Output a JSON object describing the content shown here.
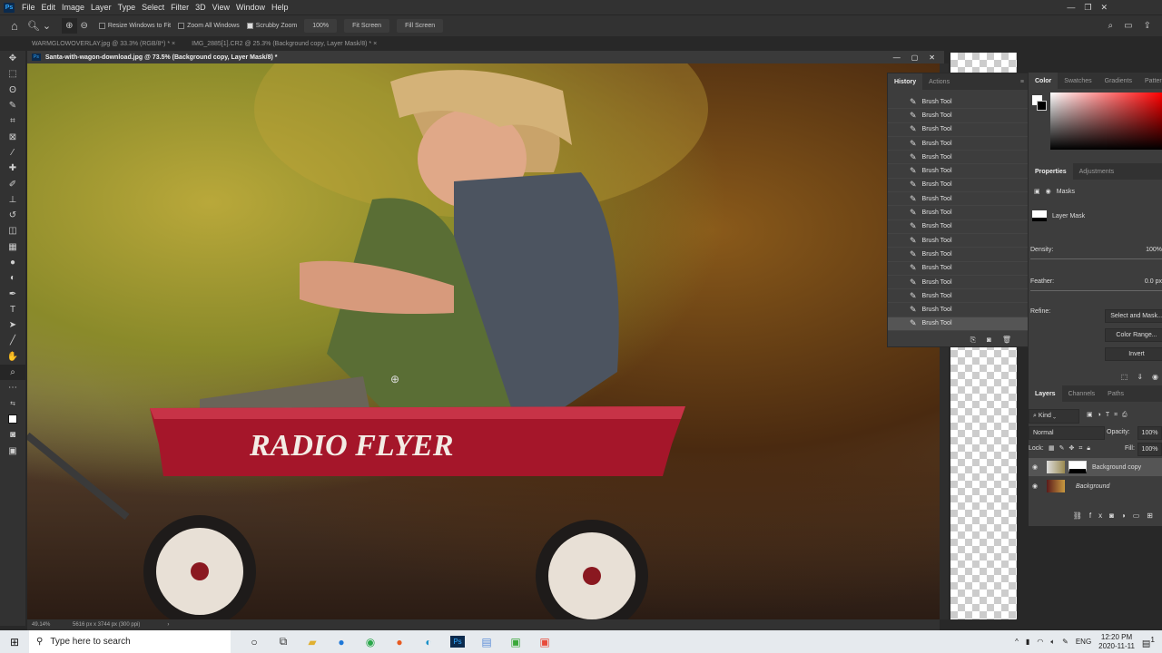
{
  "app": {
    "logo": "Ps"
  },
  "menu": [
    "File",
    "Edit",
    "Image",
    "Layer",
    "Type",
    "Select",
    "Filter",
    "3D",
    "View",
    "Window",
    "Help"
  ],
  "options": {
    "resize_windows": "Resize Windows to Fit",
    "resize_checked": false,
    "zoom_all": "Zoom All Windows",
    "zoom_all_checked": false,
    "scrubby": "Scrubby Zoom",
    "scrubby_checked": true,
    "zoom_value": "100%",
    "fit_screen": "Fit Screen",
    "fill_screen": "Fill Screen"
  },
  "tabs": [
    {
      "label": "WARMGLOWOVERLAY.jpg @ 33.3% (RGB/8*) *",
      "close": "×"
    },
    {
      "label": "IMG_2885[1].CR2 @ 25.3% (Background copy, Layer Mask/8) *",
      "close": "×"
    }
  ],
  "document": {
    "title": "Santa-with-wagon-download.jpg @ 73.5% (Background copy, Layer Mask/8) *",
    "logo_text": "RADIO FLYER"
  },
  "status": {
    "zoom": "49.14%",
    "size": "5616 px x 3744 px (300 ppi)"
  },
  "history": {
    "tabs": [
      "History",
      "Actions"
    ],
    "items": [
      "Brush Tool",
      "Brush Tool",
      "Brush Tool",
      "Brush Tool",
      "Brush Tool",
      "Brush Tool",
      "Brush Tool",
      "Brush Tool",
      "Brush Tool",
      "Brush Tool",
      "Brush Tool",
      "Brush Tool",
      "Brush Tool",
      "Brush Tool",
      "Brush Tool",
      "Brush Tool",
      "Brush Tool"
    ]
  },
  "color_panel": {
    "tabs": [
      "Color",
      "Swatches",
      "Gradients",
      "Patterns"
    ],
    "hue": "#ff0000"
  },
  "properties": {
    "tabs": [
      "Properties",
      "Adjustments"
    ],
    "masks": "Masks",
    "layer_mask": "Layer Mask",
    "density_label": "Density:",
    "density": "100%",
    "feather_label": "Feather:",
    "feather": "0.0 px",
    "refine_label": "Refine:",
    "select_and_mask": "Select and Mask...",
    "color_range": "Color Range...",
    "invert": "Invert"
  },
  "layers": {
    "tabs": [
      "Layers",
      "Channels",
      "Paths"
    ],
    "kind": "Kind",
    "blend": "Normal",
    "opacity_label": "Opacity:",
    "opacity": "100%",
    "lock_label": "Lock:",
    "fill_label": "Fill:",
    "fill": "100%",
    "items": [
      {
        "name": "Background copy"
      },
      {
        "name": "Background"
      }
    ]
  },
  "taskbar": {
    "search_placeholder": "Type here to search",
    "lang": "ENG",
    "time": "12:20 PM",
    "date": "2020-11-11",
    "notifications": "1"
  }
}
